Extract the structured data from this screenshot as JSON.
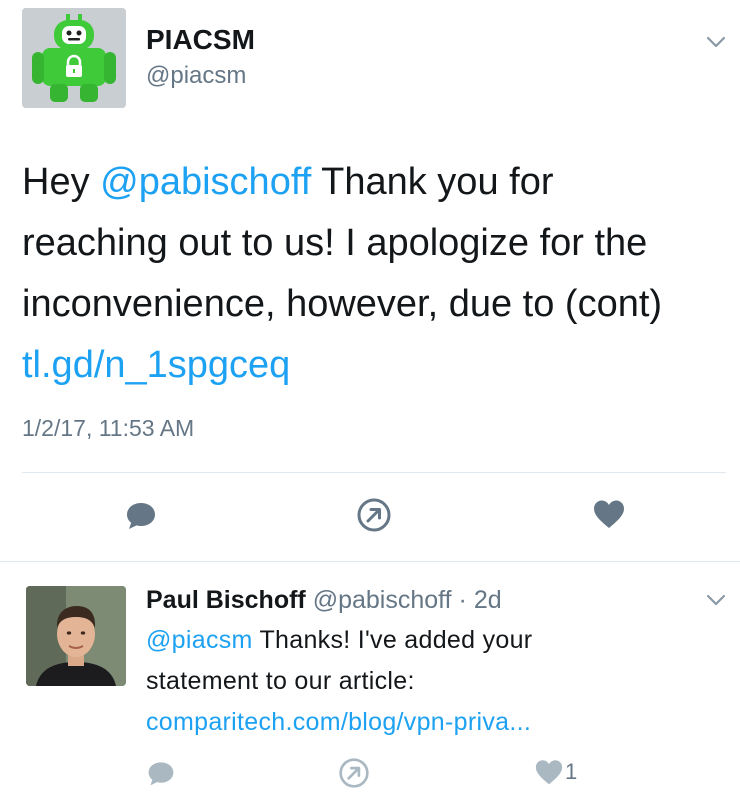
{
  "main_tweet": {
    "author_name": "PIACSM",
    "author_handle": "@piacsm",
    "avatar_icon": "pia-robot-logo-icon",
    "text": {
      "line1_prefix": "Hey ",
      "line1_mention": "@pabischoff",
      "line1_suffix": " Thank you for",
      "line2": "reaching out to us! I apologize for the",
      "line3": "inconvenience, however, due to (cont)",
      "link": "tl.gd/n_1spgceq"
    },
    "timestamp": "1/2/17, 11:53 AM",
    "actions": {
      "reply_icon": "reply-bubble-icon",
      "retweet_icon": "retweet-circle-icon",
      "like_icon": "heart-icon"
    }
  },
  "reply_tweet": {
    "author_name": "Paul Bischoff",
    "author_handle": "@pabischoff",
    "separator": "·",
    "time": "2d",
    "text": {
      "mention": "@piacsm",
      "line1_suffix": " Thanks! I've added your",
      "line2": "statement to our article:",
      "link": "comparitech.com/blog/vpn-priva..."
    },
    "like_count": "1",
    "actions": {
      "reply_icon": "reply-bubble-icon",
      "retweet_icon": "retweet-circle-icon",
      "like_icon": "heart-icon"
    }
  },
  "colors": {
    "link": "#1da1f2",
    "secondary_text": "#657786",
    "icon": "#657786",
    "divider": "#e1e8ed",
    "pia_green": "#3fca3a"
  }
}
